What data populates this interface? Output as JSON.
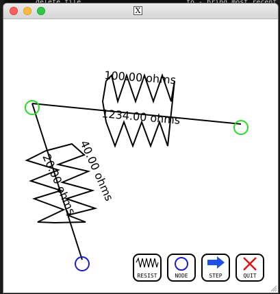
{
  "background": {
    "term_line_1": "delete file",
    "term_line_2": "fo - bring most recent"
  },
  "window": {
    "title_icon": "X"
  },
  "resistors": [
    {
      "label": "100.00 ohms"
    },
    {
      "label": "1234.00 ohms"
    },
    {
      "label": "40.00 ohms"
    },
    {
      "label": "20.00 ohms"
    }
  ],
  "toolbar": {
    "resist_label": "RESIST",
    "node_label": "NODE",
    "step_label": "STEP",
    "quit_label": "QUIT"
  },
  "colors": {
    "node_green": "#22dd22",
    "node_blue": "#1a1acc",
    "step_arrow": "#1f4fe6",
    "quit_x": "#e01010"
  }
}
